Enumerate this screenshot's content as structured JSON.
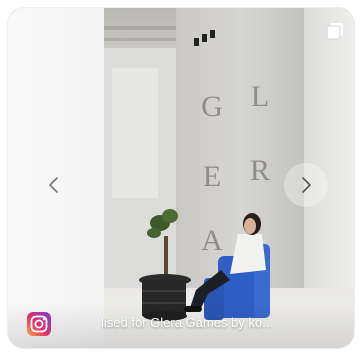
{
  "post": {
    "caption": "lised for Glera Games by ko...",
    "wall_letters": [
      "G",
      "L",
      "E",
      "R",
      "A"
    ]
  },
  "icons": {
    "previous": "chevron-left-icon",
    "next": "chevron-right-icon",
    "gallery": "multiple-images-icon",
    "instagram": "instagram-icon"
  },
  "colors": {
    "chair_blue": "#2f5fc4",
    "caption_text": "#ffffff",
    "nav_chevron": "#777777"
  }
}
